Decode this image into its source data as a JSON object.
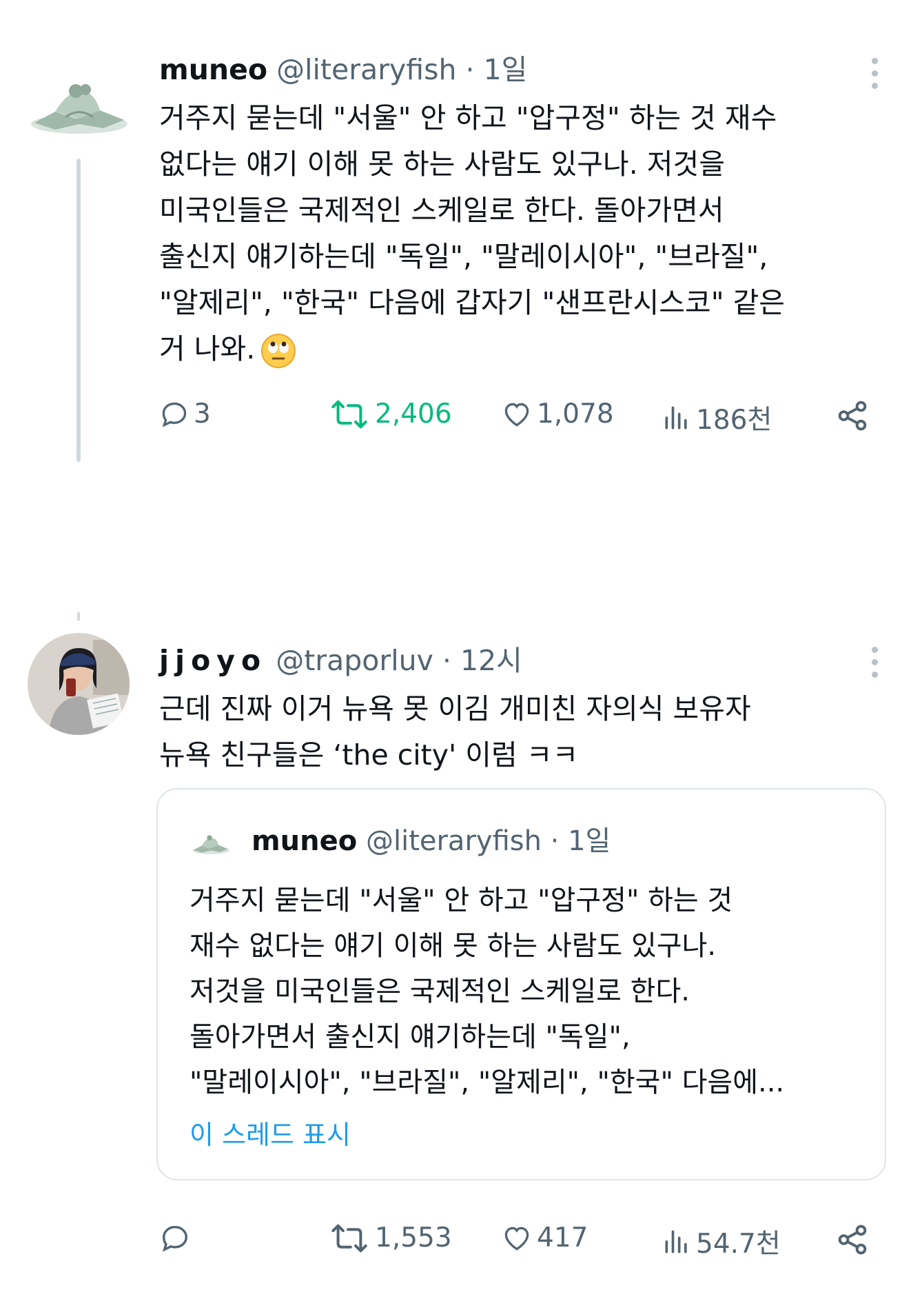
{
  "tweet1": {
    "name": "muneo",
    "handle": "@literaryfish",
    "time": "· 1일",
    "lines": [
      "거주지 묻는데 \"서울\" 안 하고 \"압구정\" 하는 것 재수",
      "없다는 얘기 이해 못 하는 사람도 있구나. 저것을",
      "미국인들은 국제적인 스케일로 한다. 돌아가면서",
      "출신지 얘기하는데 \"독일\", \"말레이시아\", \"브라질\",",
      "\"알제리\", \"한국\" 다음에 갑자기 \"샌프란시스코\" 같은",
      "거 나와."
    ],
    "emoji": "eye-roll-emoji",
    "replies": "3",
    "retweets": "2,406",
    "likes": "1,078",
    "views": "186천"
  },
  "tweet2": {
    "name": "jjoyo",
    "handle": "@traporluv",
    "time": "· 12시",
    "lines": [
      "근데 진짜 이거 뉴욕 못 이김 개미친 자의식 보유자",
      "뉴욕 친구들은 ‘the city' 이럼 ㅋㅋ"
    ],
    "retweets": "1,553",
    "likes": "417",
    "views": "54.7천"
  },
  "quote": {
    "name": "muneo",
    "handle": "@literaryfish",
    "time": "· 1일",
    "lines": [
      "거주지 묻는데 \"서울\" 안 하고 \"압구정\" 하는 것",
      "재수 없다는 얘기 이해 못 하는 사람도 있구나.",
      "저것을 미국인들은 국제적인 스케일로 한다.",
      "돌아가면서 출신지 얘기하는데 \"독일\",",
      "\"말레이시아\", \"브라질\", \"알제리\", \"한국\" 다음에..."
    ],
    "show_thread": "이 스레드 표시"
  },
  "colors": {
    "text": "#0f1419",
    "secondary": "#536471",
    "retweet_active": "#00ba7c",
    "link": "#1d9bf0",
    "border": "#dfe5e9"
  }
}
